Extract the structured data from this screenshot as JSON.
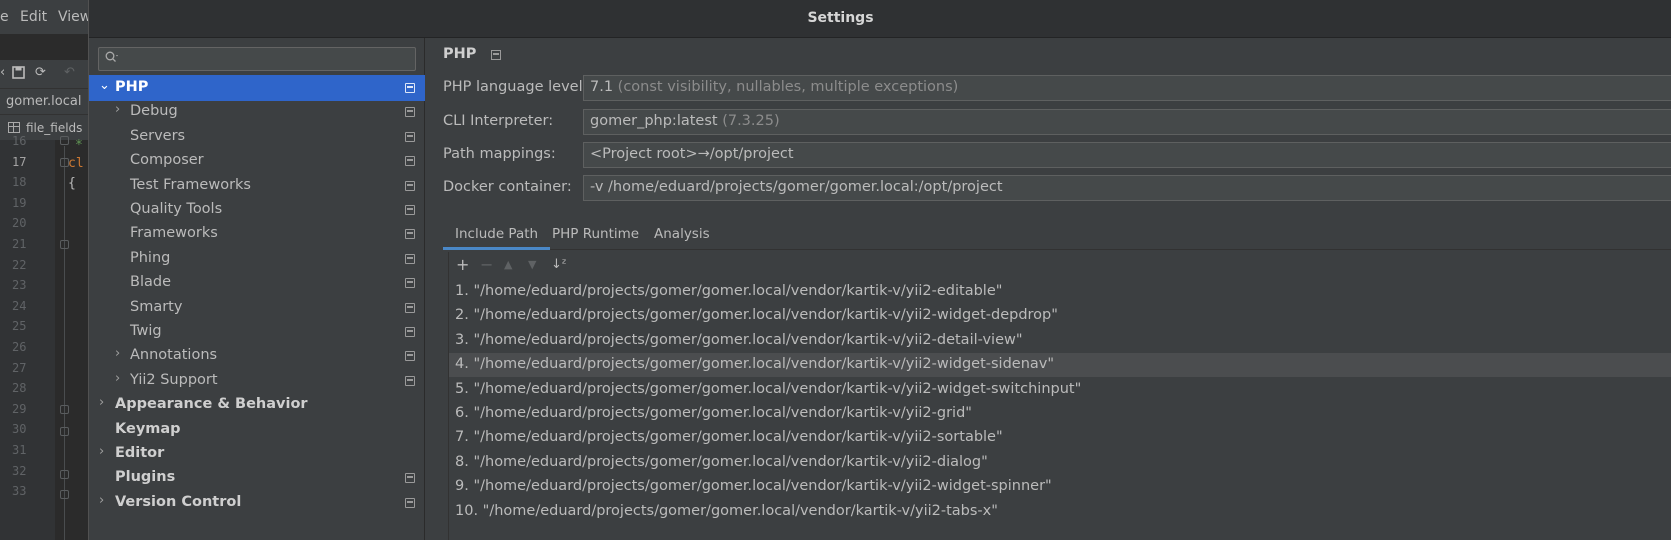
{
  "ide": {
    "menu": [
      "e",
      "Edit",
      "View"
    ],
    "file_tab": "gomer.local",
    "breadcrumb": "file_fields",
    "line_numbers": [
      "16",
      "17",
      "18",
      "19",
      "20",
      "21",
      "22",
      "23",
      "24",
      "25",
      "26",
      "27",
      "28",
      "29",
      "30",
      "31",
      "32",
      "33"
    ],
    "code_line_16": "*",
    "code_line_17": "cl",
    "code_line_18": "{"
  },
  "dialog": {
    "title": "Settings",
    "search": {
      "placeholder": "",
      "value": ""
    }
  },
  "tree": {
    "items": [
      {
        "label": "PHP",
        "arrow": "⌄",
        "selected": true,
        "bold": true,
        "icon": true
      },
      {
        "label": "Debug",
        "arrow": "›",
        "icon": true
      },
      {
        "label": "Servers",
        "icon": true
      },
      {
        "label": "Composer",
        "icon": true
      },
      {
        "label": "Test Frameworks",
        "icon": true
      },
      {
        "label": "Quality Tools",
        "icon": true
      },
      {
        "label": "Frameworks",
        "icon": true
      },
      {
        "label": "Phing",
        "icon": true
      },
      {
        "label": "Blade",
        "icon": true
      },
      {
        "label": "Smarty",
        "icon": true
      },
      {
        "label": "Twig",
        "icon": true
      },
      {
        "label": "Annotations",
        "arrow": "›",
        "icon": true
      },
      {
        "label": "Yii2 Support",
        "arrow": "›",
        "icon": true
      },
      {
        "label": "Appearance & Behavior",
        "arrow": "›",
        "bold": true
      },
      {
        "label": "Keymap",
        "bold": true
      },
      {
        "label": "Editor",
        "arrow": "›",
        "bold": true
      },
      {
        "label": "Plugins",
        "bold": true,
        "icon": true
      },
      {
        "label": "Version Control",
        "arrow": "›",
        "bold": true,
        "icon": true
      }
    ]
  },
  "php": {
    "heading": "PHP",
    "fields": {
      "language_level_label": "PHP language level:",
      "language_level_value": "7.1",
      "language_level_desc": "(const visibility, nullables, multiple exceptions)",
      "cli_label": "CLI Interpreter:",
      "cli_value": "gomer_php:latest",
      "cli_version": "(7.3.25)",
      "path_label": "Path mappings:",
      "path_value": "<Project root>→/opt/project",
      "docker_label": "Docker container:",
      "docker_value": "-v /home/eduard/projects/gomer/gomer.local:/opt/project"
    },
    "tabs": [
      "Include Path",
      "PHP Runtime",
      "Analysis"
    ],
    "active_tab": "Include Path",
    "toolbar": {
      "add": "+",
      "remove": "−",
      "up": "▲",
      "down": "▼",
      "sort": "↓ᶻ"
    },
    "include_paths": [
      "1. \"/home/eduard/projects/gomer/gomer.local/vendor/kartik-v/yii2-editable\"",
      "2. \"/home/eduard/projects/gomer/gomer.local/vendor/kartik-v/yii2-widget-depdrop\"",
      "3. \"/home/eduard/projects/gomer/gomer.local/vendor/kartik-v/yii2-detail-view\"",
      "4. \"/home/eduard/projects/gomer/gomer.local/vendor/kartik-v/yii2-widget-sidenav\"",
      "5. \"/home/eduard/projects/gomer/gomer.local/vendor/kartik-v/yii2-widget-switchinput\"",
      "6. \"/home/eduard/projects/gomer/gomer.local/vendor/kartik-v/yii2-grid\"",
      "7. \"/home/eduard/projects/gomer/gomer.local/vendor/kartik-v/yii2-sortable\"",
      "8. \"/home/eduard/projects/gomer/gomer.local/vendor/kartik-v/yii2-dialog\"",
      "9. \"/home/eduard/projects/gomer/gomer.local/vendor/kartik-v/yii2-widget-spinner\"",
      "10. \"/home/eduard/projects/gomer/gomer.local/vendor/kartik-v/yii2-tabs-x\""
    ]
  },
  "colors": {
    "accent": "#2f65ca",
    "tab_underline": "#4a88c7",
    "background": "#3c3f41"
  }
}
